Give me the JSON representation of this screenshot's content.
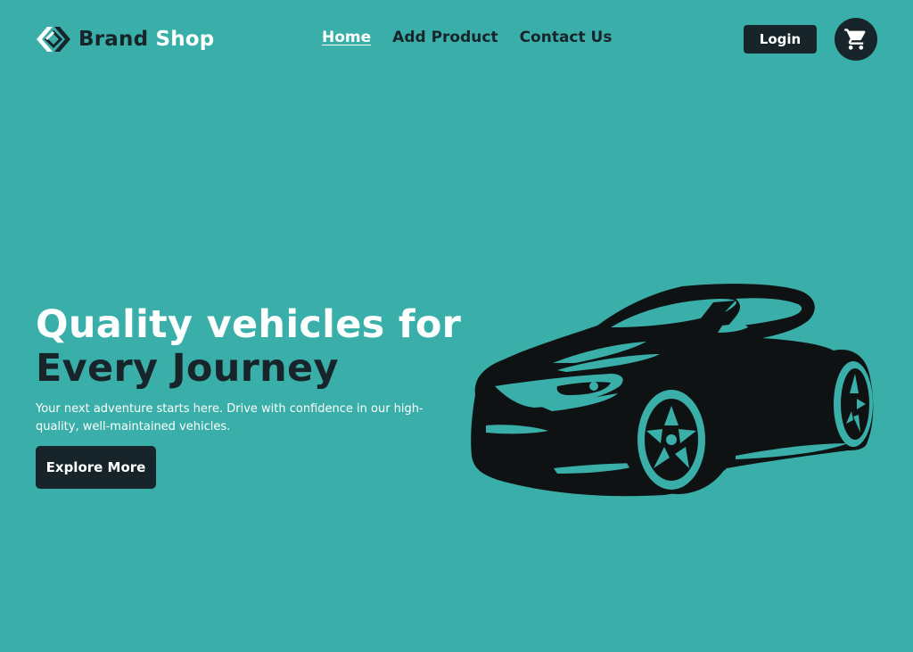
{
  "brand": {
    "name_part1": "Brand",
    "name_part2": "Shop",
    "logo_icon": "diamond-logo-icon"
  },
  "nav": {
    "links": [
      {
        "label": "Home",
        "active": true
      },
      {
        "label": "Add Product",
        "active": false
      },
      {
        "label": "Contact Us",
        "active": false
      }
    ],
    "login_label": "Login",
    "cart_icon": "shopping-cart-icon"
  },
  "hero": {
    "title_line1": "Quality vehicles for",
    "title_line2": "Every Journey",
    "subtitle": "Your next adventure starts here. Drive with confidence in our high-quality, well-maintained vehicles.",
    "cta_label": "Explore More",
    "image": "sports-car-silhouette"
  },
  "colors": {
    "background": "#3aafa9",
    "dark": "#17252a",
    "light": "#feffff"
  }
}
